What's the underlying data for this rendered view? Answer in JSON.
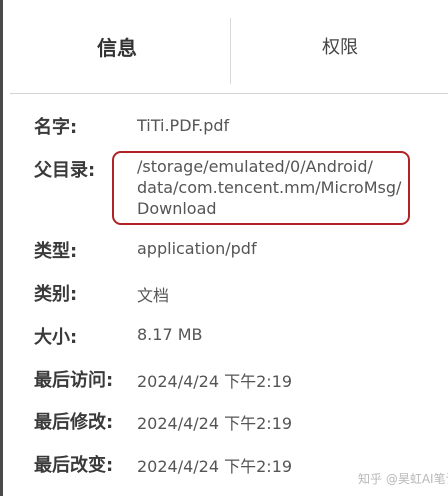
{
  "tabs": {
    "info": "信息",
    "permissions": "权限"
  },
  "details": {
    "name_label": "名字:",
    "name_value": "TiTi.PDF.pdf",
    "parent_label": "父目录:",
    "parent_value_lines": [
      "/storage/emulated/0/Android/",
      "data/com.tencent.mm/MicroMsg/",
      "Download"
    ],
    "type_label": "类型:",
    "type_value": "application/pdf",
    "category_label": "类别:",
    "category_value": "文档",
    "size_label": "大小:",
    "size_value": "8.17 MB",
    "accessed_label": "最后访问:",
    "accessed_value": "2024/4/24 下午2:19",
    "modified_label": "最后修改:",
    "modified_value": "2024/4/24 下午2:19",
    "changed_label": "最后改变:",
    "changed_value": "2024/4/24 下午2:19"
  },
  "watermark": {
    "text": "知乎 @昊虹AI笔记",
    "icon": "at-icon"
  },
  "colors": {
    "highlight_border": "#b02226",
    "divider": "#d4d4d4",
    "label_text": "#3a3a3a",
    "value_text": "#555555"
  }
}
